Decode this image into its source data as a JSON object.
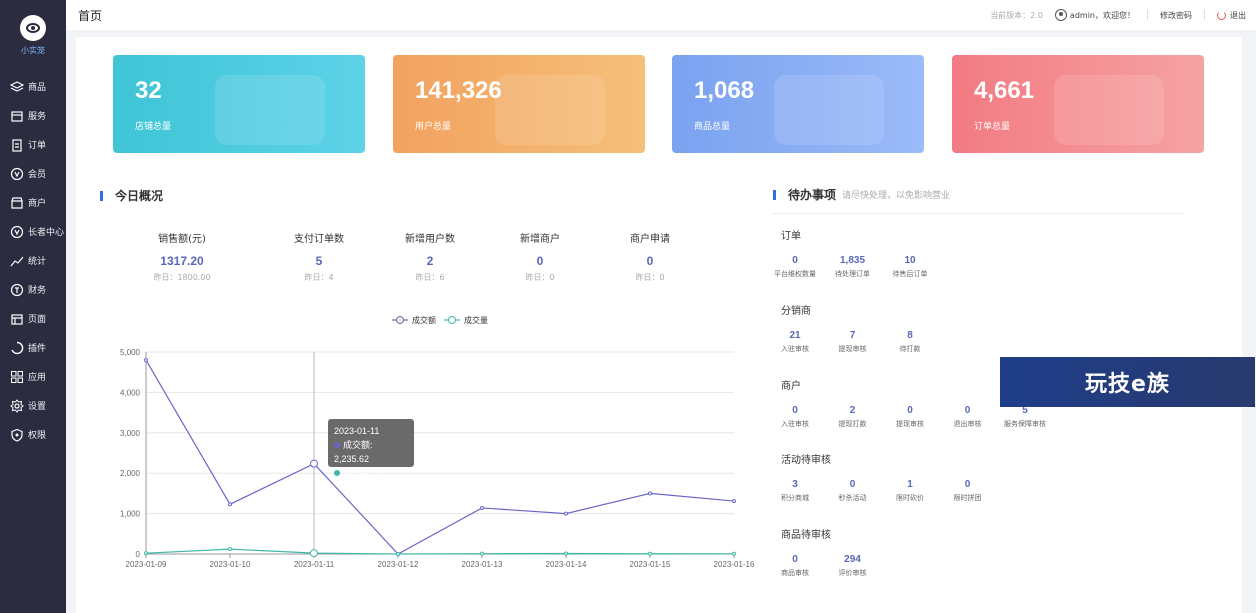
{
  "brand": {
    "name": "小实笼"
  },
  "sidebar": {
    "items": [
      {
        "label": "商品",
        "icon": "layers-icon"
      },
      {
        "label": "服务",
        "icon": "box-icon"
      },
      {
        "label": "订单",
        "icon": "clipboard-icon"
      },
      {
        "label": "会员",
        "icon": "vip-icon"
      },
      {
        "label": "商户",
        "icon": "store-icon"
      },
      {
        "label": "长者中心",
        "icon": "vip-icon"
      },
      {
        "label": "统计",
        "icon": "chart-line-icon"
      },
      {
        "label": "财务",
        "icon": "coin-icon"
      },
      {
        "label": "页面",
        "icon": "page-icon"
      },
      {
        "label": "插件",
        "icon": "plugin-icon"
      },
      {
        "label": "应用",
        "icon": "apps-icon"
      },
      {
        "label": "设置",
        "icon": "gear-icon"
      },
      {
        "label": "权限",
        "icon": "shield-icon"
      }
    ]
  },
  "header": {
    "title": "首页",
    "version": "当前版本：2.0",
    "user": "admin，欢迎您！",
    "change_password": "修改密码",
    "logout": "退出"
  },
  "cards": [
    {
      "value": "32",
      "label": "店铺总量"
    },
    {
      "value": "141,326",
      "label": "用户总量"
    },
    {
      "value": "1,068",
      "label": "商品总量"
    },
    {
      "value": "4,661",
      "label": "订单总量"
    }
  ],
  "today": {
    "title": "今日概况",
    "stats": [
      {
        "title": "销售额(元)",
        "value": "1317.20",
        "yesterday": "昨日：1800.00"
      },
      {
        "title": "支付订单数",
        "value": "5",
        "yesterday": "昨日：4"
      },
      {
        "title": "新增用户数",
        "value": "2",
        "yesterday": "昨日：6"
      },
      {
        "title": "新增商户",
        "value": "0",
        "yesterday": "昨日：0"
      },
      {
        "title": "商户申请",
        "value": "0",
        "yesterday": "昨日：0"
      }
    ]
  },
  "chart_data": {
    "type": "line",
    "x": [
      "2023-01-09",
      "2023-01-10",
      "2023-01-11",
      "2023-01-12",
      "2023-01-13",
      "2023-01-14",
      "2023-01-15",
      "2023-01-16"
    ],
    "series": [
      {
        "name": "成交额",
        "color": "#6a66c6",
        "values": [
          4800,
          1230,
          2235.62,
          0,
          1140,
          1000,
          1500,
          1310
        ]
      },
      {
        "name": "成交量",
        "color": "#3fb7a8",
        "values": [
          20,
          120,
          22,
          0,
          8,
          12,
          6,
          5
        ]
      }
    ],
    "yticks": [
      "0",
      "1,000",
      "2,000",
      "3,000",
      "4,000",
      "5,000"
    ],
    "ylim": [
      0,
      5000
    ],
    "legend": "top-center",
    "grid": true
  },
  "tooltip": {
    "date": "2023-01-11",
    "line1": "成交额: 2,235.62",
    "line2": "成交量: 22"
  },
  "todo": {
    "title": "待办事项",
    "subtitle": "请尽快处理，以免影响营业",
    "groups": [
      {
        "title": "订单",
        "items": [
          {
            "value": "0",
            "label": "平台维权数量"
          },
          {
            "value": "1,835",
            "label": "待处理订单"
          },
          {
            "value": "10",
            "label": "待售后订单"
          }
        ]
      },
      {
        "title": "分销商",
        "items": [
          {
            "value": "21",
            "label": "入驻审核"
          },
          {
            "value": "7",
            "label": "提现审核"
          },
          {
            "value": "8",
            "label": "待打款"
          }
        ]
      },
      {
        "title": "商户",
        "items": [
          {
            "value": "0",
            "label": "入驻审核"
          },
          {
            "value": "2",
            "label": "提现打款"
          },
          {
            "value": "0",
            "label": "提现审核"
          },
          {
            "value": "0",
            "label": "退出审核"
          },
          {
            "value": "5",
            "label": "服务保障审核"
          }
        ]
      },
      {
        "title": "活动待审核",
        "items": [
          {
            "value": "3",
            "label": "积分商城"
          },
          {
            "value": "0",
            "label": "秒杀活动"
          },
          {
            "value": "1",
            "label": "限时砍价"
          },
          {
            "value": "0",
            "label": "限时拼团"
          }
        ]
      },
      {
        "title": "商品待审核",
        "items": [
          {
            "value": "0",
            "label": "商品审核"
          },
          {
            "value": "294",
            "label": "评价审核"
          }
        ]
      }
    ]
  },
  "watermark": "玩技e族"
}
